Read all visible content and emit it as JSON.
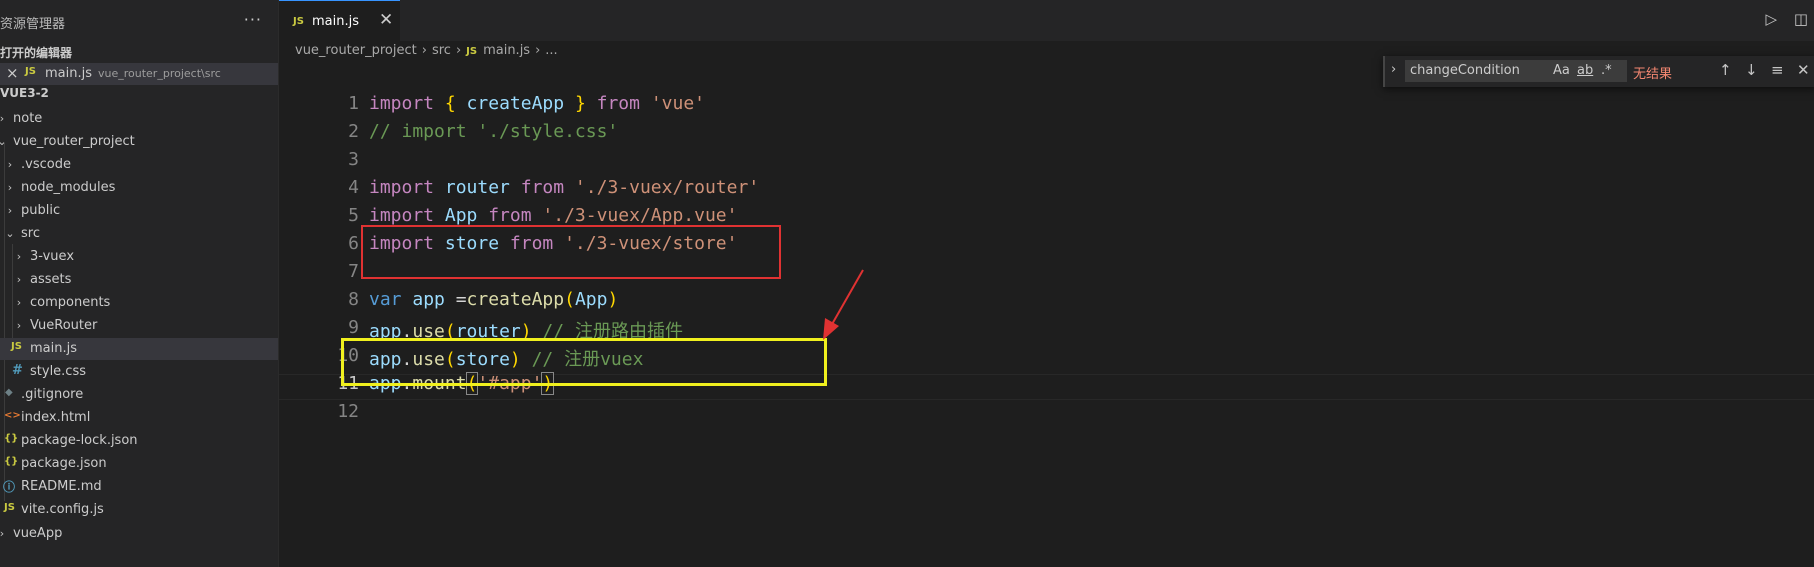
{
  "sidebar": {
    "title": "资源管理器",
    "more": "···",
    "open_editors_header": "打开的编辑器",
    "open_editor": {
      "name": "main.js",
      "path": "vue_router_project\\src",
      "icon": "JS"
    },
    "workspace_header": "VUE3-2",
    "tree": [
      {
        "label": "note",
        "icon": ""
      },
      {
        "label": "vue_router_project",
        "icon": ""
      },
      {
        "label": ".vscode",
        "icon": ""
      },
      {
        "label": "node_modules",
        "icon": ""
      },
      {
        "label": "public",
        "icon": ""
      },
      {
        "label": "src",
        "icon": ""
      },
      {
        "label": "3-vuex",
        "icon": ""
      },
      {
        "label": "assets",
        "icon": ""
      },
      {
        "label": "components",
        "icon": ""
      },
      {
        "label": "VueRouter",
        "icon": ""
      },
      {
        "label": "main.js",
        "icon": "JS"
      },
      {
        "label": "style.css",
        "icon": "#"
      },
      {
        "label": ".gitignore",
        "icon": "◆"
      },
      {
        "label": "index.html",
        "icon": "<>"
      },
      {
        "label": "package-lock.json",
        "icon": "{}"
      },
      {
        "label": "package.json",
        "icon": "{}"
      },
      {
        "label": "README.md",
        "icon": "ⓘ"
      },
      {
        "label": "vite.config.js",
        "icon": "JS"
      },
      {
        "label": "vueApp",
        "icon": ""
      }
    ]
  },
  "tab": {
    "label": "main.js",
    "icon": "JS"
  },
  "breadcrumb": {
    "a": "vue_router_project",
    "b": "src",
    "c": "main.js",
    "d": "..."
  },
  "find": {
    "query": "changeCondition",
    "case": "Aa",
    "word": "ab",
    "regex": ".*",
    "result": "无结果"
  },
  "line_numbers": [
    "1",
    "2",
    "3",
    "4",
    "5",
    "6",
    "7",
    "8",
    "9",
    "10",
    "11",
    "12"
  ],
  "code": {
    "l1": [
      "import",
      " ",
      "{",
      " createApp ",
      "}",
      " from ",
      "'vue'"
    ],
    "l2": "// import './style.css'",
    "l4": [
      "import",
      " router ",
      "from",
      " './3-vuex/router'"
    ],
    "l5": [
      "import",
      " App ",
      "from",
      " './3-vuex/App.vue'"
    ],
    "l6": [
      "import",
      " store ",
      "from",
      " './3-vuex/store'"
    ],
    "l8": [
      "var",
      " app ",
      "=",
      "createApp",
      "(",
      "App",
      ")"
    ],
    "l9": [
      "app",
      ".",
      "use",
      "(",
      "router",
      ")",
      " // 注册路由插件"
    ],
    "l10": [
      "app",
      ".",
      "use",
      "(",
      "store",
      ")",
      " // 注册vuex"
    ],
    "l11": [
      "app",
      ".",
      "mount",
      "(",
      "'#app'",
      ")"
    ]
  },
  "colors": {
    "red_box": "#e03232",
    "yellow_box": "#f0f01e",
    "arrow": "#e03232"
  }
}
